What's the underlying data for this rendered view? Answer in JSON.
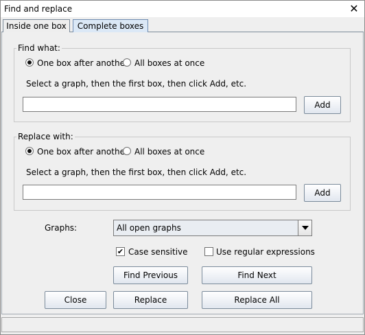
{
  "window": {
    "title": "Find and replace",
    "close_glyph": "✕",
    "close_icon": "close-icon"
  },
  "tabs": [
    {
      "label": "Inside one box",
      "active": false
    },
    {
      "label": "Complete boxes",
      "active": true
    }
  ],
  "find": {
    "group_label": "Find what:",
    "options": [
      {
        "label": "One box after another",
        "checked": true
      },
      {
        "label": "All boxes at once",
        "checked": false
      }
    ],
    "instruction": "Select a graph, then the first box, then click Add, etc.",
    "value": "",
    "add_label": "Add"
  },
  "replace": {
    "group_label": "Replace with:",
    "options": [
      {
        "label": "One box after another",
        "checked": true
      },
      {
        "label": "All boxes at once",
        "checked": false
      }
    ],
    "instruction": "Select a graph, then the first box, then click Add, etc.",
    "value": "",
    "add_label": "Add"
  },
  "graphs": {
    "label": "Graphs:",
    "selected": "All open graphs"
  },
  "options": {
    "case_sensitive": {
      "label": "Case sensitive",
      "checked": true,
      "mark": "✔"
    },
    "regex": {
      "label": "Use regular expressions",
      "checked": false
    }
  },
  "buttons": {
    "find_previous": "Find Previous",
    "find_next": "Find Next",
    "close": "Close",
    "replace": "Replace",
    "replace_all": "Replace All"
  },
  "status": {
    "text": ""
  }
}
